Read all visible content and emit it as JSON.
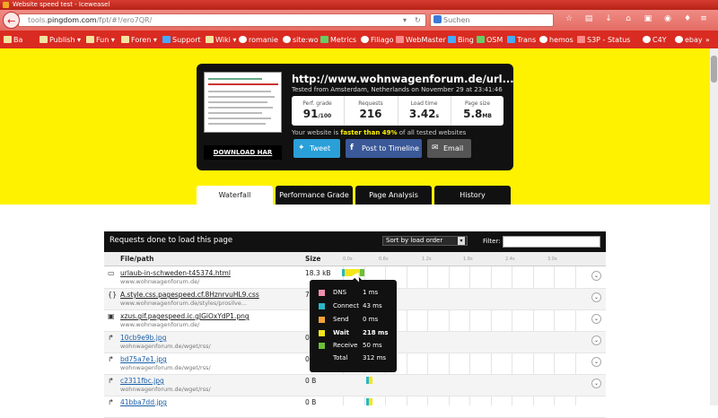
{
  "window": {
    "title": "Website speed test - Iceweasel"
  },
  "toolbar": {
    "url_prefix": "tools.",
    "url_domain": "pingdom.com",
    "url_rest": "/fpt/#!/ero7QR/",
    "search_placeholder": "Suchen"
  },
  "bookmarks": [
    "Ba",
    "Publish",
    "Fun",
    "Foren",
    "Support",
    "Wiki",
    "romanie",
    "site:wo",
    "Metrics",
    "Filiago",
    "WebMaster",
    "Bing",
    "OSM",
    "Trans",
    "hemos",
    "S3P - Status",
    "C4Y",
    "ebay"
  ],
  "summary": {
    "url": "http://www.wohnwagenforum.de/url...",
    "tested": "Tested from Amsterdam, Netherlands on November 29 at 23:41:46",
    "download_har": "DOWNLOAD HAR",
    "stats": [
      {
        "label": "Perf. grade",
        "value": "91",
        "unit": "/100"
      },
      {
        "label": "Requests",
        "value": "216",
        "unit": ""
      },
      {
        "label": "Load time",
        "value": "3.42",
        "unit": "s"
      },
      {
        "label": "Page size",
        "value": "5.8",
        "unit": "MB"
      }
    ],
    "faster_pre": "Your website is ",
    "faster_bold": "faster than 49%",
    "faster_post": " of all tested websites",
    "tweet": "Tweet",
    "timeline": "Post to Timeline",
    "email": "Email"
  },
  "tabs": [
    "Waterfall",
    "Performance Grade",
    "Page Analysis",
    "History"
  ],
  "requests": {
    "title": "Requests done to load this page",
    "sort": "Sort by load order",
    "filter_label": "Filter:",
    "col_file": "File/path",
    "col_size": "Size",
    "ticks": [
      "0.0s",
      "0.6s",
      "1.2s",
      "1.8s",
      "2.4s",
      "3.0s"
    ],
    "rows": [
      {
        "file": "urlaub-in-schweden-t45374.html",
        "path": "www.wohnwagenforum.de/",
        "size": "18.3 kB",
        "icon": "document-icon",
        "link": false
      },
      {
        "file": "A.style.css.pagespeed.cf.8HznrvuHL9.css",
        "path": "www.wohnwagenforum.de/styles/prosilve...",
        "size": "7",
        "icon": "css-icon",
        "link": false
      },
      {
        "file": "xzus.gif.pagespeed.ic.gJGiOxYdP1.png",
        "path": "www.wohnwagenforum.de/",
        "size": "",
        "icon": "image-icon",
        "link": false
      },
      {
        "file": "10cb9e9b.jpg",
        "path": "wohnwagenforum.de/wget/rss/",
        "size": "0",
        "icon": "redirect-icon",
        "link": true
      },
      {
        "file": "bd75a7e1.jpg",
        "path": "wohnwagenforum.de/wget/rss/",
        "size": "0",
        "icon": "redirect-icon",
        "link": true
      },
      {
        "file": "c2311fbc.jpg",
        "path": "wohnwagenforum.de/wget/rss/",
        "size": "0 B",
        "icon": "redirect-icon",
        "link": true
      },
      {
        "file": "41bba7dd.jpg",
        "path": "",
        "size": "0 B",
        "icon": "redirect-icon",
        "link": true
      }
    ]
  },
  "tooltip": {
    "rows": [
      {
        "label": "DNS",
        "value": "1 ms",
        "color": "#f48fb1"
      },
      {
        "label": "Connect",
        "value": "43 ms",
        "color": "#29b6c6"
      },
      {
        "label": "Send",
        "value": "0 ms",
        "color": "#f5a23a"
      },
      {
        "label": "Wait",
        "value": "218 ms",
        "color": "#f5e61a"
      },
      {
        "label": "Receive",
        "value": "50 ms",
        "color": "#6bbf3a"
      },
      {
        "label": "Total",
        "value": "312 ms",
        "color": ""
      }
    ]
  },
  "colors": {
    "brand_yellow": "#fff200",
    "browser_red": "#d92b21",
    "tweet": "#2b9fd8",
    "facebook": "#3b5998",
    "email": "#555555"
  }
}
